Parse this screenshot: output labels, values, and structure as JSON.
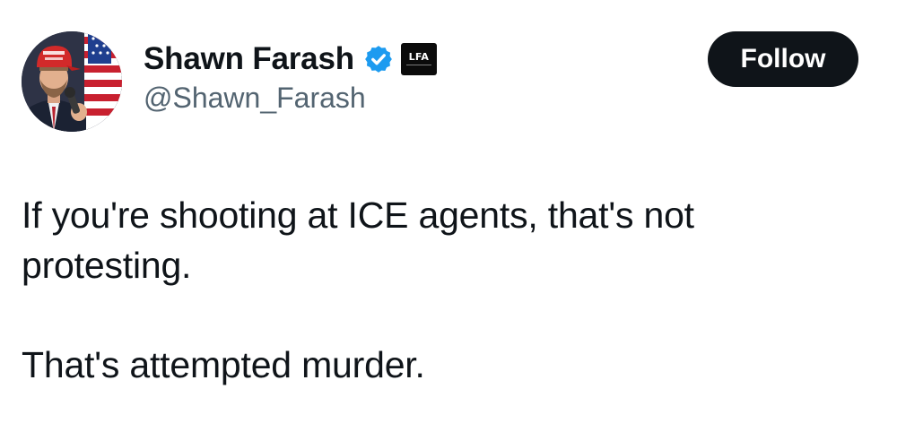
{
  "author": {
    "display_name": "Shawn Farash",
    "handle": "@Shawn_Farash",
    "verified": true,
    "affiliate_badge_text": "LFA",
    "avatar_icon": "profile-photo"
  },
  "follow_button": {
    "label": "Follow"
  },
  "tweet": {
    "lines": [
      "If you're shooting at ICE agents, that's not protesting.",
      "That's attempted murder."
    ]
  },
  "colors": {
    "text_primary": "#0f1419",
    "text_secondary": "#536471",
    "verified_blue": "#1d9bf0",
    "button_bg": "#0f1419",
    "button_text": "#ffffff"
  }
}
